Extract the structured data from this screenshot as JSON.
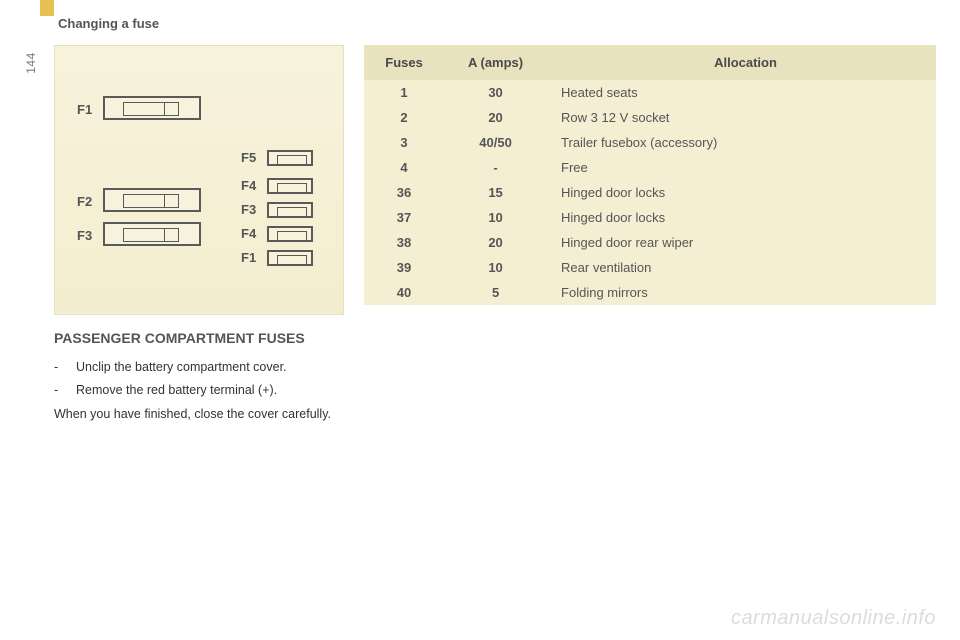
{
  "page_number": "144",
  "header": "Changing a fuse",
  "diagram": {
    "big_labels": [
      "F1",
      "F2",
      "F3"
    ],
    "small_labels": [
      "F5",
      "F4",
      "F3",
      "F4",
      "F1"
    ]
  },
  "subheading": "PASSENGER COMPARTMENT FUSES",
  "instructions": {
    "items": [
      "Unclip the battery compartment cover.",
      "Remove the red battery terminal (+)."
    ],
    "closing": "When you have finished, close the cover carefully."
  },
  "table": {
    "headers": {
      "fuses": "Fuses",
      "amps": "A (amps)",
      "allocation": "Allocation"
    },
    "rows": [
      {
        "fuse": "1",
        "amps": "30",
        "allocation": "Heated seats"
      },
      {
        "fuse": "2",
        "amps": "20",
        "allocation": "Row 3 12 V socket"
      },
      {
        "fuse": "3",
        "amps": "40/50",
        "allocation": "Trailer fusebox (accessory)"
      },
      {
        "fuse": "4",
        "amps": "-",
        "allocation": "Free"
      },
      {
        "fuse": "36",
        "amps": "15",
        "allocation": "Hinged door locks"
      },
      {
        "fuse": "37",
        "amps": "10",
        "allocation": "Hinged door locks"
      },
      {
        "fuse": "38",
        "amps": "20",
        "allocation": "Hinged door rear wiper"
      },
      {
        "fuse": "39",
        "amps": "10",
        "allocation": "Rear ventilation"
      },
      {
        "fuse": "40",
        "amps": "5",
        "allocation": "Folding mirrors"
      }
    ]
  },
  "watermark": "carmanualsonline.info",
  "chart_data": {
    "type": "table",
    "title": "Passenger compartment fuses",
    "columns": [
      "Fuses",
      "A (amps)",
      "Allocation"
    ],
    "rows": [
      [
        "1",
        "30",
        "Heated seats"
      ],
      [
        "2",
        "20",
        "Row 3 12 V socket"
      ],
      [
        "3",
        "40/50",
        "Trailer fusebox (accessory)"
      ],
      [
        "4",
        "-",
        "Free"
      ],
      [
        "36",
        "15",
        "Hinged door locks"
      ],
      [
        "37",
        "10",
        "Hinged door locks"
      ],
      [
        "38",
        "20",
        "Hinged door rear wiper"
      ],
      [
        "39",
        "10",
        "Rear ventilation"
      ],
      [
        "40",
        "5",
        "Folding mirrors"
      ]
    ]
  }
}
